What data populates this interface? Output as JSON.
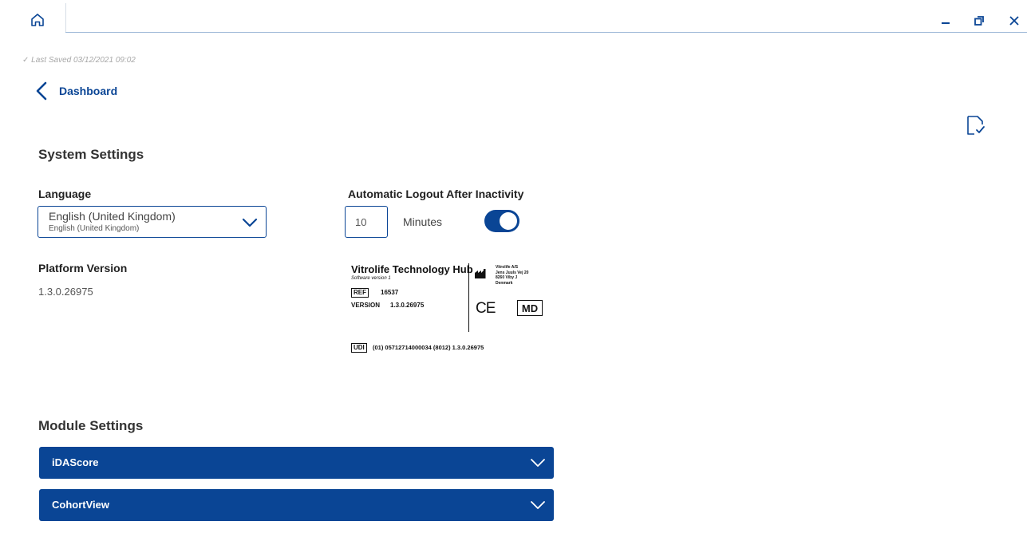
{
  "titlebar": {
    "home_icon": "home-icon",
    "minimize_icon": "minimize-icon",
    "restore_icon": "restore-icon",
    "close_icon": "close-icon"
  },
  "status": {
    "check": "✓",
    "last_saved_label": "Last Saved",
    "last_saved_time": "03/12/2021 09:02"
  },
  "nav": {
    "back_label": "Dashboard"
  },
  "system_settings": {
    "title": "System Settings",
    "language": {
      "label": "Language",
      "selected_main": "English (United Kingdom)",
      "selected_sub": "English (United Kingdom)"
    },
    "auto_logout": {
      "label": "Automatic Logout After Inactivity",
      "value": "10",
      "unit": "Minutes",
      "enabled": true
    },
    "platform_version": {
      "label": "Platform Version",
      "value": "1.3.0.26975"
    }
  },
  "product_label": {
    "title": "Vitrolife Technology Hub",
    "subtitle": "Software version 1",
    "ref_tag": "REF",
    "ref_value": "16537",
    "version_tag": "VERSION",
    "version_value": "1.3.0.26975",
    "manufacturer_lines": [
      "Vitrolife A/S",
      "Jens Juuls Vej 20",
      "8260 Viby J",
      "Denmark"
    ],
    "ce_mark": "CE",
    "md_mark": "MD",
    "udi_tag": "UDI",
    "udi_value": "(01) 05712714000034 (8012) 1.3.0.26975"
  },
  "module_settings": {
    "title": "Module Settings",
    "modules": [
      {
        "label": "iDAScore"
      },
      {
        "label": "CohortView"
      }
    ]
  },
  "colors": {
    "accent": "#0a4595",
    "muted_text": "#a8a8a8"
  }
}
